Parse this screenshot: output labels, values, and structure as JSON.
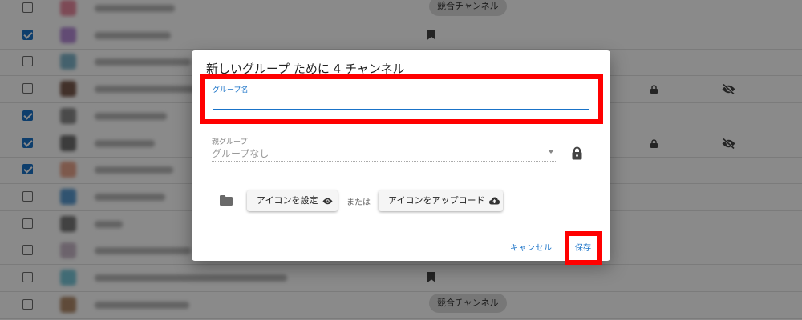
{
  "background_list": {
    "rows": [
      {
        "checked": false,
        "thumb_color": "#e88aa0",
        "text_width": 100,
        "badge": "chip",
        "chip_label": "競合チャンネル"
      },
      {
        "checked": true,
        "thumb_color": "#b58bd6",
        "text_width": 95,
        "badge": "bookmark"
      },
      {
        "checked": false,
        "thumb_color": "#7fb4c9",
        "text_width": 120,
        "badge": "none"
      },
      {
        "checked": false,
        "thumb_color": "#7a5b4e",
        "text_width": 170,
        "badge": "lock-eye"
      },
      {
        "checked": true,
        "thumb_color": "#8a8a8a",
        "text_width": 90,
        "badge": "none"
      },
      {
        "checked": true,
        "thumb_color": "#6f6f6f",
        "text_width": 75,
        "badge": "lock-eye"
      },
      {
        "checked": true,
        "thumb_color": "#e8a48c",
        "text_width": 98,
        "badge": "none"
      },
      {
        "checked": false,
        "thumb_color": "#5a9ad0",
        "text_width": 88,
        "badge": "none"
      },
      {
        "checked": false,
        "thumb_color": "#7a7a7a",
        "text_width": 35,
        "badge": "none"
      },
      {
        "checked": false,
        "thumb_color": "#c8b8c8",
        "text_width": 120,
        "badge": "none"
      },
      {
        "checked": false,
        "thumb_color": "#79c6d8",
        "text_width": 240,
        "badge": "bookmark"
      },
      {
        "checked": false,
        "thumb_color": "#b08a6a",
        "text_width": 118,
        "badge": "chip",
        "chip_label": "競合チャンネル"
      }
    ]
  },
  "dialog": {
    "title": "新しいグループ ために 4 チャンネル",
    "name_field": {
      "label": "グループ名",
      "value": ""
    },
    "parent_field": {
      "label": "親グループ",
      "value": "グループなし"
    },
    "or_text": "または",
    "buttons": {
      "set_icon": "アイコンを設定",
      "upload_icon": "アイコンをアップロード",
      "cancel": "キャンセル",
      "save": "保存"
    }
  },
  "colors": {
    "accent": "#1a73c8",
    "highlight": "#ff0000",
    "overlay": "rgba(0,0,0,0.46)"
  }
}
